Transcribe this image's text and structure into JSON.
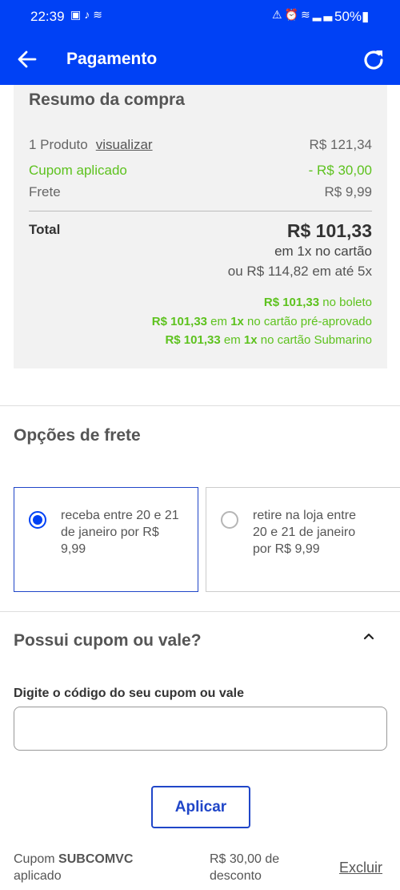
{
  "status_bar": {
    "time": "22:39",
    "battery": "50%",
    "icons_left": [
      "image-icon",
      "tiktok-icon",
      "app-icon"
    ],
    "icons_right": [
      "alarm-icon",
      "clock-icon",
      "wifi-icon",
      "signal-icon",
      "battery-icon"
    ]
  },
  "header": {
    "title": "Pagamento",
    "bg_color": "#0041f5"
  },
  "summary": {
    "title": "Resumo da compra",
    "product_label": "1 Produto",
    "view_link": "visualizar",
    "product_value": "R$ 121,34",
    "coupon_label": "Cupom aplicado",
    "coupon_value": "- R$ 30,00",
    "shipping_label": "Frete",
    "shipping_value": "R$ 9,99",
    "total_label": "Total",
    "total_value": "R$ 101,33",
    "total_sub1": "em 1x no cartão",
    "total_sub2": "ou R$ 114,82 em até 5x",
    "alternatives": [
      {
        "price": "R$ 101,33",
        "text": " no boleto"
      },
      {
        "price": "R$ 101,33",
        "mid": " em ",
        "inst": "1x",
        "text": " no cartão pré-aprovado"
      },
      {
        "price": "R$ 101,33",
        "mid": " em ",
        "inst": "1x",
        "text": " no cartão Submarino"
      }
    ],
    "accent_green": "#5dc21e"
  },
  "shipping_options": {
    "title": "Opções de frete",
    "options": [
      {
        "text": "receba entre 20 e 21 de janeiro por R$ 9,99",
        "selected": true
      },
      {
        "text": "retire na loja entre 20 e 21 de janeiro por R$ 9,99",
        "selected": false
      }
    ]
  },
  "coupon": {
    "title": "Possui cupom ou vale?",
    "field_label": "Digite o código do seu cupom ou vale",
    "input_value": "",
    "apply_label": "Aplicar",
    "applied_prefix": "Cupom ",
    "applied_code": "SUBCOMVC",
    "applied_suffix": "aplicado",
    "discount_line1": "R$ 30,00 de",
    "discount_line2": "desconto",
    "remove_label": "Excluir"
  }
}
